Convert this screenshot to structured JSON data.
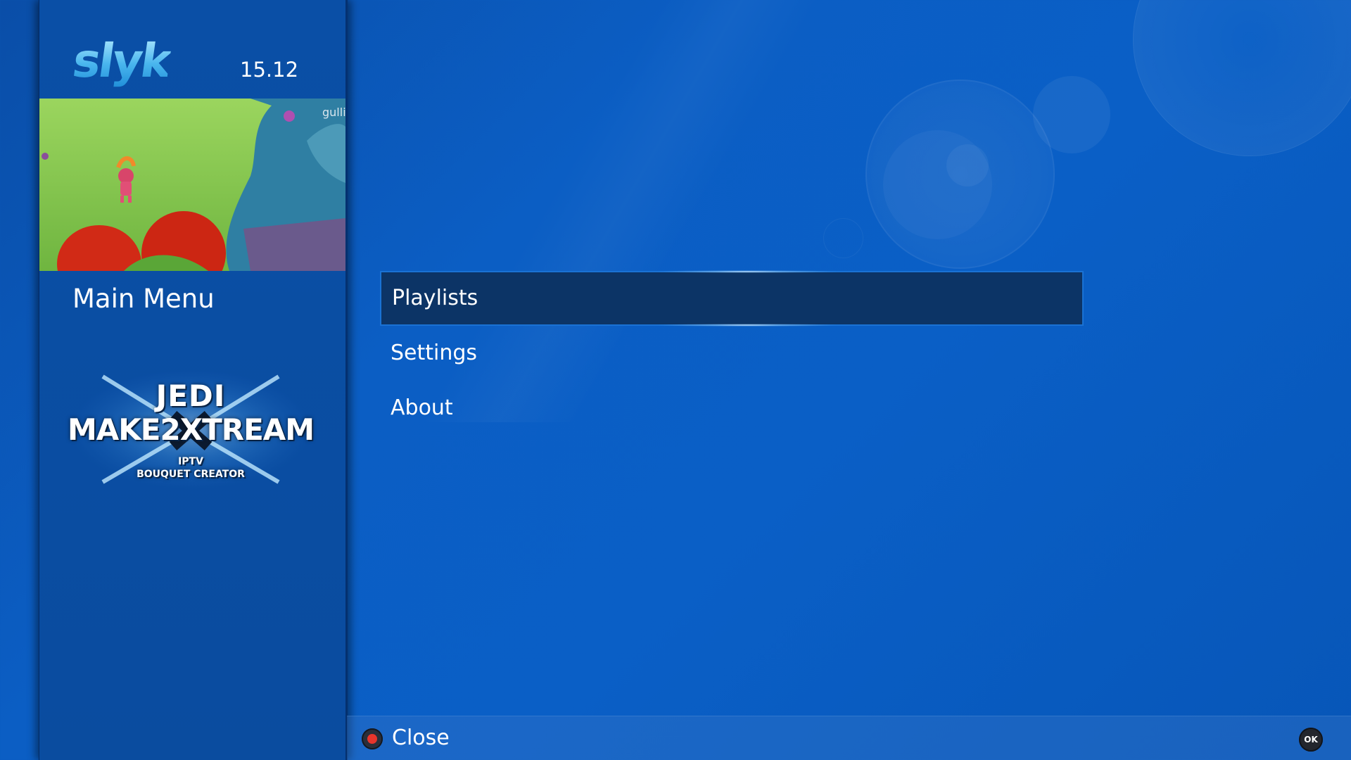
{
  "header": {
    "logo_text": "slyk",
    "clock": "15.12"
  },
  "sidebar": {
    "preview_channel_logo": "gulli",
    "section_title": "Main Menu",
    "brand": {
      "line1": "JEDI",
      "line2": "MAKE2XTREAM",
      "line3": "IPTV",
      "line4": "BOUQUET CREATOR"
    }
  },
  "menu": {
    "items": [
      {
        "label": "Playlists",
        "selected": true
      },
      {
        "label": "Settings",
        "selected": false
      },
      {
        "label": "About",
        "selected": false
      }
    ]
  },
  "footer": {
    "red_button_label": "Close",
    "ok_button_label": "OK"
  },
  "colors": {
    "background": "#0b5ec4",
    "panel": "#0a4fa6",
    "selection_bg": "#0c3466",
    "selection_border": "#1a72d4",
    "red_key": "#e8352c"
  }
}
